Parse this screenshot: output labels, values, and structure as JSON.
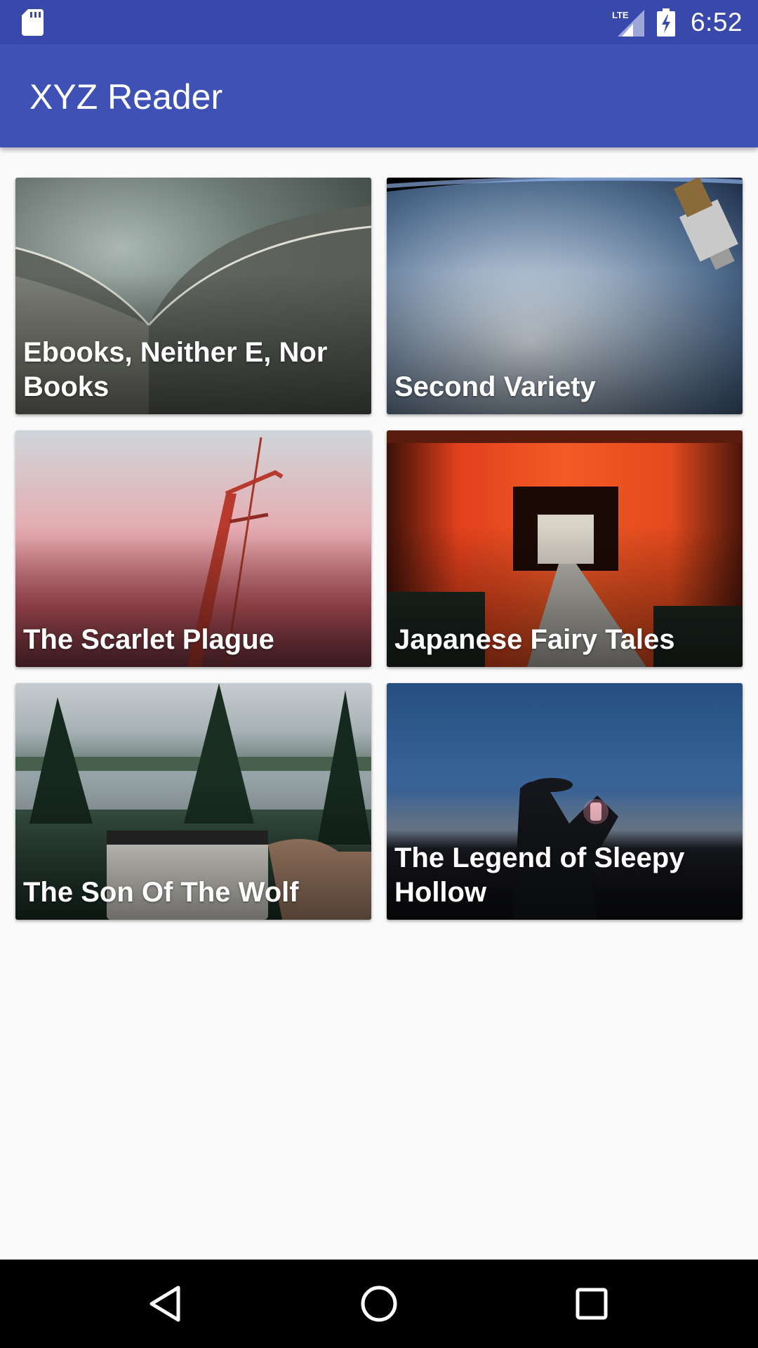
{
  "status_bar": {
    "time": "6:52",
    "network_label": "LTE",
    "icons": [
      "sd-card-icon",
      "lte-signal-icon",
      "battery-charging-icon"
    ],
    "color": "#3949ab"
  },
  "app_bar": {
    "title": "XYZ Reader",
    "color": "#3f51b5"
  },
  "articles": [
    {
      "title": "Ebooks, Neither E, Nor Books",
      "image": "opera-house-roof-photo"
    },
    {
      "title": "Second Variety",
      "image": "earth-from-orbit-photo"
    },
    {
      "title": "The Scarlet Plague",
      "image": "golden-gate-bridge-fog-photo"
    },
    {
      "title": "Japanese Fairy Tales",
      "image": "torii-gates-photo"
    },
    {
      "title": "The Son Of The Wolf",
      "image": "lake-and-mug-photo"
    },
    {
      "title": "The Legend of Sleepy Hollow",
      "image": "man-with-lantern-photo"
    }
  ],
  "nav_bar": {
    "buttons": [
      "back-icon",
      "home-icon",
      "recents-icon"
    ]
  }
}
